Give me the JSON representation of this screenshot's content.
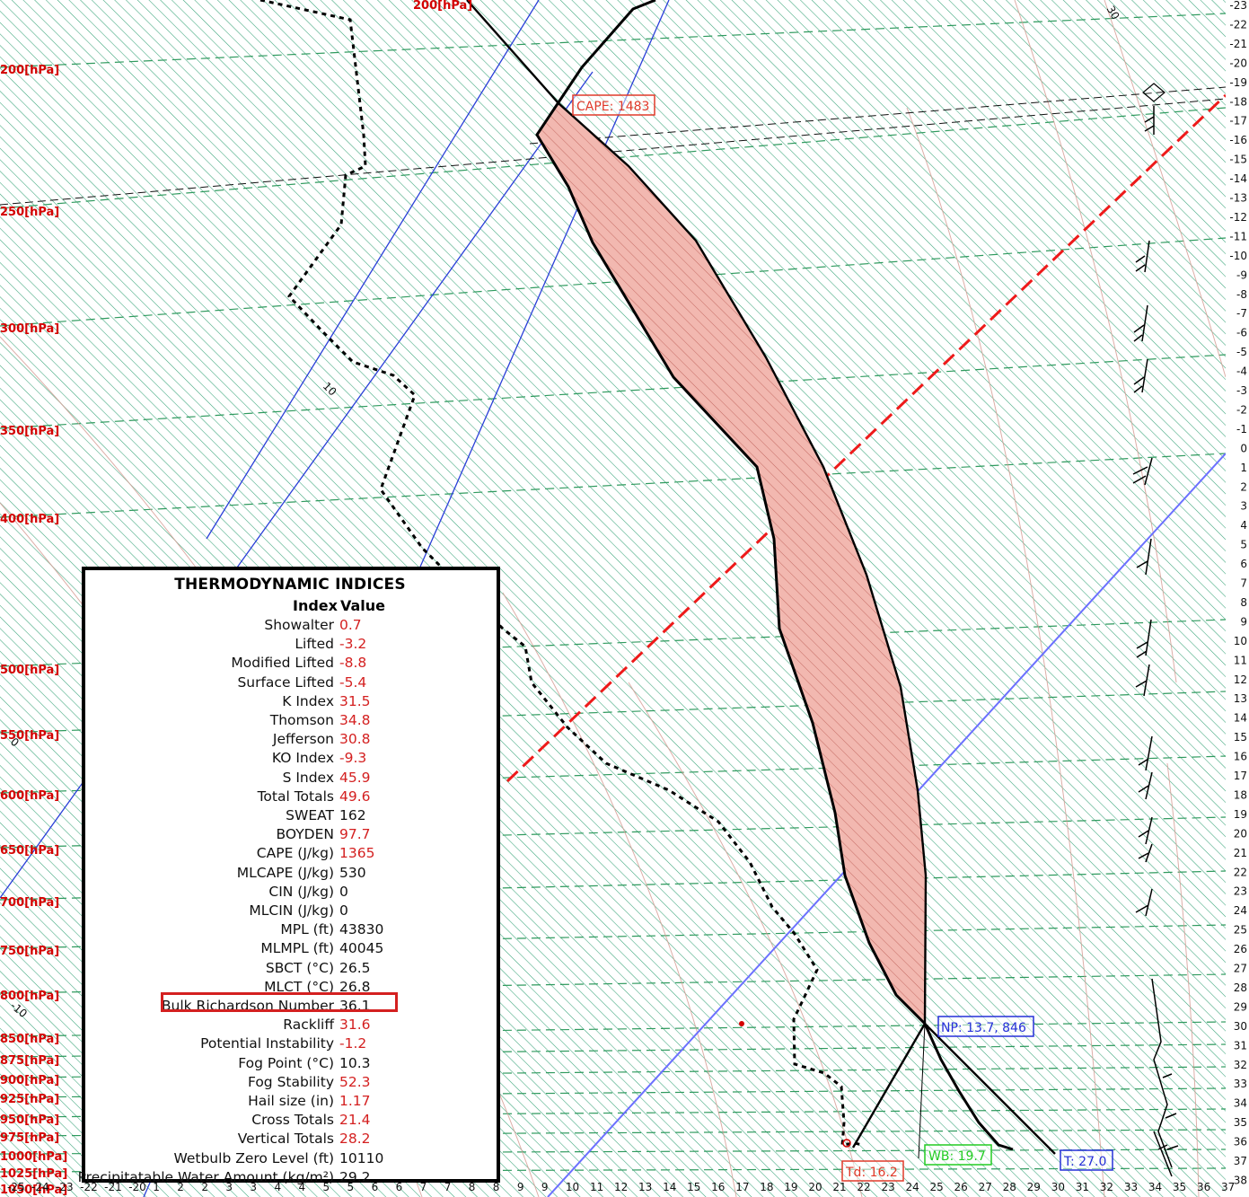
{
  "chart_data": {
    "type": "skew-t",
    "pressure_labels": [
      "200[hPa]",
      "200[hPa]",
      "250[hPa]",
      "300[hPa]",
      "350[hPa]",
      "400[hPa]",
      "500[hPa]",
      "550[hPa]",
      "600[hPa]",
      "650[hPa]",
      "700[hPa]",
      "750[hPa]",
      "800[hPa]",
      "850[hPa]",
      "875[hPa]",
      "900[hPa]",
      "925[hPa]",
      "950[hPa]",
      "975[hPa]",
      "1000[hPa]",
      "1025[hPa]",
      "1050[hPa]"
    ],
    "right_axis_labels": [
      "-23",
      "-22",
      "-21",
      "-20",
      "-19",
      "-18",
      "-17",
      "-16",
      "-15",
      "-14",
      "-13",
      "-12",
      "-11",
      "-10",
      "-9",
      "-8",
      "-7",
      "-6",
      "-5",
      "-4",
      "-3",
      "-2",
      "-1",
      "0",
      "1",
      "2",
      "3",
      "4",
      "5",
      "6",
      "7",
      "8",
      "9",
      "10",
      "11",
      "12",
      "13",
      "14",
      "15",
      "16",
      "17",
      "18",
      "19",
      "20",
      "21",
      "22",
      "23",
      "24",
      "25",
      "26",
      "27",
      "28",
      "29",
      "30",
      "31",
      "32",
      "33",
      "34",
      "35",
      "36",
      "37",
      "38"
    ],
    "bottom_axis_labels": [
      "-25",
      "-24",
      "-23",
      "-22",
      "-21",
      "-20",
      "1",
      "2",
      "2",
      "3",
      "3",
      "4",
      "4",
      "5",
      "5",
      "6",
      "6",
      "7",
      "7",
      "8",
      "8",
      "9",
      "9",
      "10",
      "11",
      "12",
      "13",
      "14",
      "15",
      "16",
      "17",
      "18",
      "19",
      "20",
      "21",
      "22",
      "23",
      "24",
      "25",
      "26",
      "27",
      "28",
      "29",
      "30",
      "31",
      "32",
      "33",
      "34",
      "35",
      "36",
      "37"
    ],
    "isotherm_labels": [
      "30",
      "10",
      "0",
      "-10"
    ],
    "annotations": {
      "cape": "CAPE: 1483",
      "np": "NP: 13.7, 846",
      "td": "Td: 16.2",
      "wb": "WB: 19.7",
      "t": "T: 27.0"
    }
  },
  "indices": {
    "title": "THERMODYNAMIC INDICES",
    "col_index": "Index",
    "col_value": "Value",
    "rows": [
      {
        "name": "Showalter",
        "value": "0.7",
        "color": "#d42020"
      },
      {
        "name": "Lifted",
        "value": "-3.2",
        "color": "#d42020"
      },
      {
        "name": "Modified Lifted",
        "value": "-8.8",
        "color": "#d42020"
      },
      {
        "name": "Surface Lifted",
        "value": "-5.4",
        "color": "#d42020"
      },
      {
        "name": "K Index",
        "value": "31.5",
        "color": "#d42020"
      },
      {
        "name": "Thomson",
        "value": "34.8",
        "color": "#d42020"
      },
      {
        "name": "Jefferson",
        "value": "30.8",
        "color": "#d42020"
      },
      {
        "name": "KO Index",
        "value": "-9.3",
        "color": "#d42020"
      },
      {
        "name": "S Index",
        "value": "45.9",
        "color": "#d42020"
      },
      {
        "name": "Total Totals",
        "value": "49.6",
        "color": "#d42020"
      },
      {
        "name": "SWEAT",
        "value": "162",
        "color": "#111111"
      },
      {
        "name": "BOYDEN",
        "value": "97.7",
        "color": "#d42020"
      },
      {
        "name": "CAPE (J/kg)",
        "value": "1365",
        "color": "#d42020"
      },
      {
        "name": "MLCAPE (J/kg)",
        "value": "530",
        "color": "#111111"
      },
      {
        "name": "CIN (J/kg)",
        "value": "0",
        "color": "#111111"
      },
      {
        "name": "MLCIN (J/kg)",
        "value": "0",
        "color": "#111111"
      },
      {
        "name": "MPL (ft)",
        "value": "43830",
        "color": "#111111"
      },
      {
        "name": "MLMPL (ft)",
        "value": "40045",
        "color": "#111111"
      },
      {
        "name": "SBCT (°C)",
        "value": "26.5",
        "color": "#111111"
      },
      {
        "name": "MLCT (°C)",
        "value": "26.8",
        "color": "#111111"
      },
      {
        "name": "Bulk Richardson Number",
        "value": "36.1",
        "color": "#111111"
      },
      {
        "name": "Rackliff",
        "value": "31.6",
        "color": "#d42020"
      },
      {
        "name": "Potential Instability",
        "value": "-1.2",
        "color": "#d42020"
      },
      {
        "name": "Fog Point (°C)",
        "value": "10.3",
        "color": "#111111"
      },
      {
        "name": "Fog Stability",
        "value": "52.3",
        "color": "#d42020"
      },
      {
        "name": "Hail size (in)",
        "value": "1.17",
        "color": "#d42020"
      },
      {
        "name": "Cross Totals",
        "value": "21.4",
        "color": "#d42020"
      },
      {
        "name": "Vertical Totals",
        "value": "28.2",
        "color": "#d42020"
      },
      {
        "name": "Wetbulb Zero Level (ft)",
        "value": "10110",
        "color": "#111111"
      },
      {
        "name": "Precipitatable Water Amount (kg/m²)",
        "value": "29.2",
        "color": "#111111"
      }
    ]
  }
}
